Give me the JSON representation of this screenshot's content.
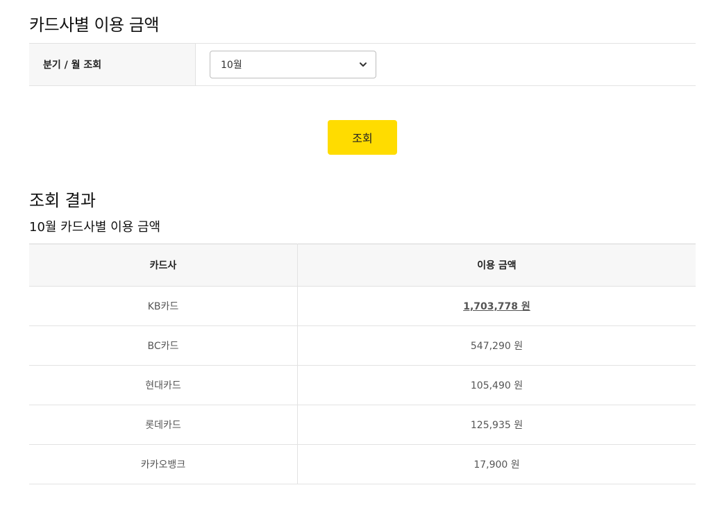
{
  "page": {
    "title": "카드사별 이용 금액"
  },
  "filter": {
    "label": "분기 / 월 조회",
    "selected": "10월"
  },
  "actions": {
    "search_label": "조회"
  },
  "result": {
    "title": "조회 결과",
    "subtitle": "10월 카드사별 이용 금액",
    "columns": [
      "카드사",
      "이용 금액"
    ],
    "rows": [
      {
        "card": "KB카드",
        "amount": "1,703,778 원"
      },
      {
        "card": "BC카드",
        "amount": "547,290 원"
      },
      {
        "card": "현대카드",
        "amount": "105,490 원"
      },
      {
        "card": "롯데카드",
        "amount": "125,935 원"
      },
      {
        "card": "카카오뱅크",
        "amount": "17,900 원"
      }
    ]
  },
  "colors": {
    "accent": "#ffdc00",
    "header_bg": "#f7f7f7",
    "border": "#e2e2e2"
  },
  "icons": {
    "select_chevron": "chevron-down-icon"
  }
}
